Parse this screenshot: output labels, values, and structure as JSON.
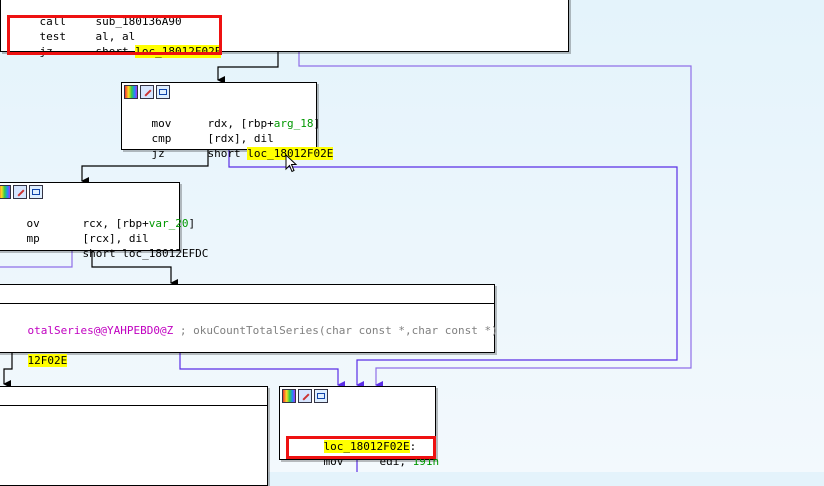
{
  "block_top": {
    "line1": {
      "mnemonic": "call",
      "operand": "sub_180136A90"
    },
    "line2": {
      "mnemonic": "test",
      "operand": "al, al"
    },
    "line3": {
      "mnemonic": "jz",
      "prefix": "short ",
      "target": "loc_18012F02E"
    }
  },
  "block_mid": {
    "line1": {
      "mnemonic": "mov",
      "op_a": "rdx, [rbp+",
      "var": "arg_18",
      "op_b": "]"
    },
    "line2": {
      "mnemonic": "cmp",
      "operand": "[rdx], dil"
    },
    "line3": {
      "mnemonic": "jz",
      "prefix": "short ",
      "target": "loc_18012F02E"
    }
  },
  "block_left": {
    "line1": {
      "mnemonic": "ov",
      "op_a": "rcx, [rbp+",
      "var": "var_20",
      "op_b": "]"
    },
    "line2": {
      "mnemonic": "mp",
      "operand": "[rcx], dil"
    },
    "line3": {
      "mnemonic": "",
      "operand": "short loc_18012EFDC"
    }
  },
  "block_wide": {
    "symbol": "otalSeries@@YAHPEBD0@Z",
    "comment": " ; okuCountTotalSeries(char const *,char const *)",
    "target": "12F02E"
  },
  "block_target": {
    "label": "loc_18012F02E",
    "label_suffix": ":",
    "mnemonic": "mov",
    "operand": "edi, ",
    "value": "191h"
  },
  "colors": {
    "highlight": "#ffff00",
    "edge_black": "#000000",
    "edge_purple": "#5a2ee6",
    "edge_lilac": "#8f6fe8",
    "red_box": "#ee1111"
  }
}
